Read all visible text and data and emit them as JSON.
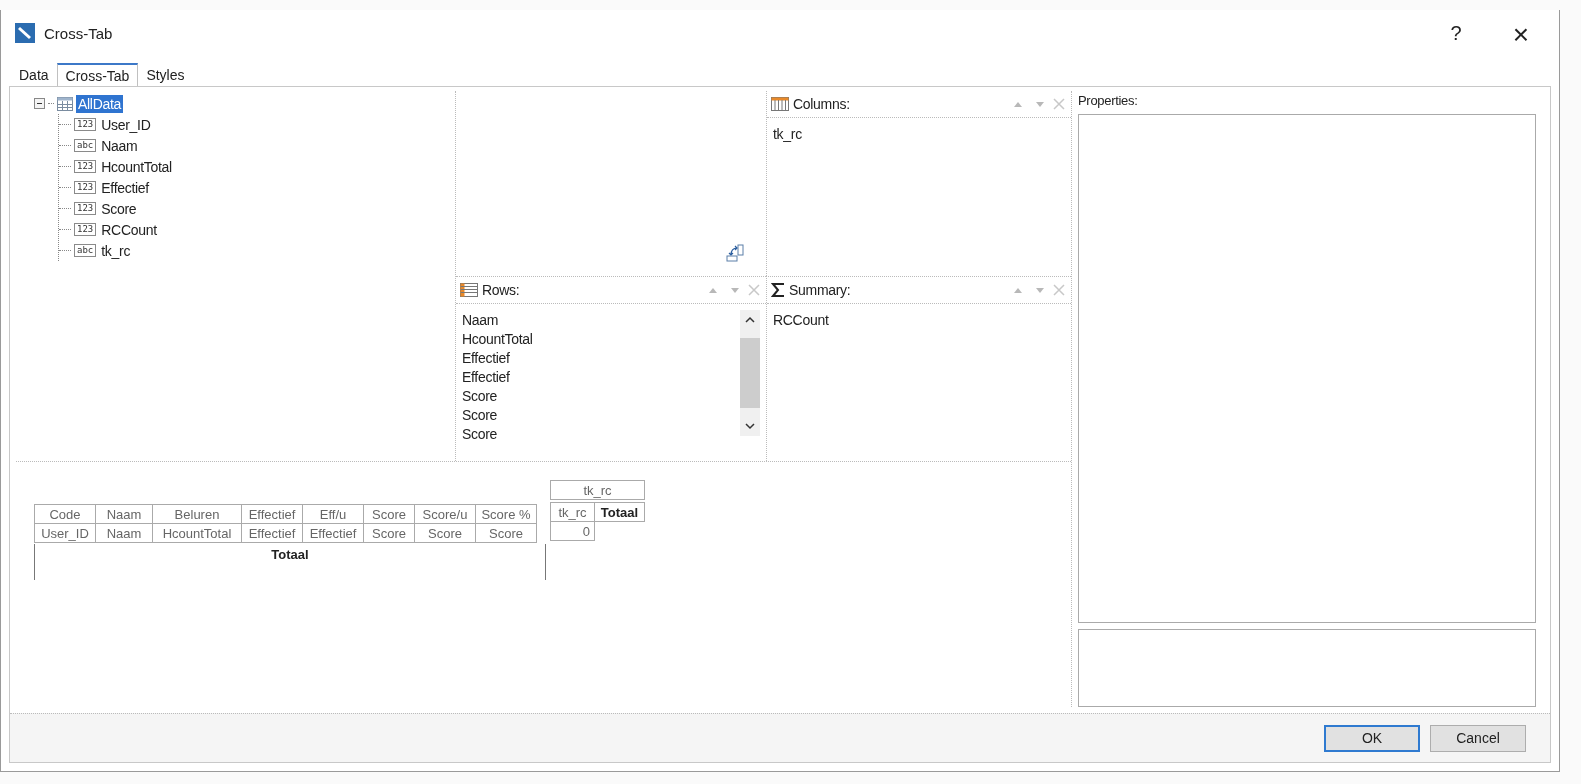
{
  "window": {
    "title": "Cross-Tab",
    "help": "?",
    "close": "×"
  },
  "tabs": [
    {
      "label": "Data",
      "selected": false
    },
    {
      "label": "Cross-Tab",
      "selected": true
    },
    {
      "label": "Styles",
      "selected": false
    }
  ],
  "tree": {
    "label": "AllData",
    "selected": true,
    "expanded": true,
    "children": [
      {
        "label": "User_ID",
        "badge": "123"
      },
      {
        "label": "Naam",
        "badge": "abc"
      },
      {
        "label": "HcountTotal",
        "badge": "123"
      },
      {
        "label": "Effectief",
        "badge": "123"
      },
      {
        "label": "Score",
        "badge": "123"
      },
      {
        "label": "RCCount",
        "badge": "123"
      },
      {
        "label": "tk_rc",
        "badge": "abc"
      }
    ]
  },
  "columns_panel": {
    "title": "Columns:",
    "items": [
      "tk_rc"
    ]
  },
  "rows_panel": {
    "title": "Rows:",
    "items": [
      "Naam",
      "HcountTotal",
      "Effectief",
      "Effectief",
      "Score",
      "Score",
      "Score"
    ]
  },
  "summary_panel": {
    "title": "Summary:",
    "items": [
      "RCCount"
    ]
  },
  "properties": {
    "label": "Properties:"
  },
  "preview": {
    "column_field": "tk_rc",
    "header_cells": [
      "Code",
      "Naam",
      "Beluren",
      "Effectief",
      "Eff/u",
      "Score",
      "Score/u",
      "Score %"
    ],
    "data_cells": [
      "User_ID",
      "Naam",
      "HcountTotal",
      "Effectief",
      "Effectief",
      "Score",
      "Score",
      "Score"
    ],
    "column_header_cells": [
      {
        "text": "tk_rc",
        "bold": false
      },
      {
        "text": "Totaal",
        "bold": true
      }
    ],
    "value_cells": [
      "0"
    ],
    "total_label": "Totaal"
  },
  "buttons": [
    {
      "label": "OK",
      "default": true
    },
    {
      "label": "Cancel",
      "default": false
    }
  ]
}
